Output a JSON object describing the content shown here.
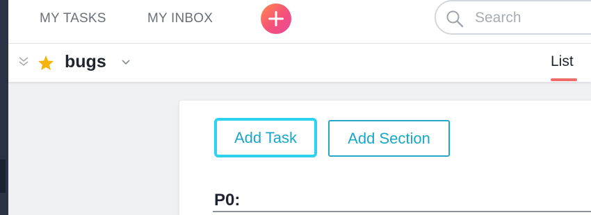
{
  "topbar": {
    "my_tasks": "MY TASKS",
    "my_inbox": "MY INBOX",
    "search_placeholder": "Search",
    "add_button_icon": "plus-icon"
  },
  "project": {
    "title": "bugs",
    "favorite_icon": "star-icon",
    "tabs": [
      {
        "label": "List",
        "active": true
      }
    ]
  },
  "actions": {
    "add_task": "Add Task",
    "add_section": "Add Section"
  },
  "sections": [
    {
      "name": "P0:"
    }
  ],
  "colors": {
    "accent_cyan": "#2dd2ef",
    "button_text": "#1aa7c7",
    "active_tab_underline": "#f06a6a",
    "star": "#f5b40b",
    "sidebar_dark": "#2b3346"
  }
}
